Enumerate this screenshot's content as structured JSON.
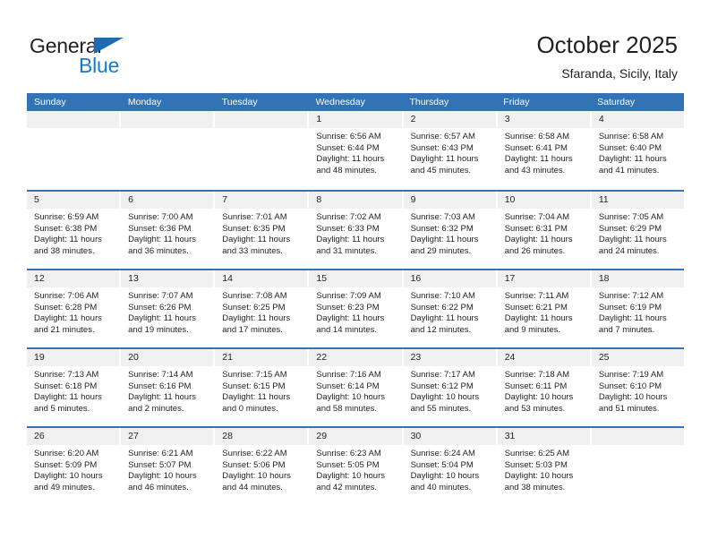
{
  "brand": {
    "name_top": "General",
    "name_bottom": "Blue",
    "triangle_color": "#1c6cb5",
    "text_color": "#231f20",
    "blue_text_color": "#1c79c8"
  },
  "header": {
    "title": "October 2025",
    "subtitle": "Sfaranda, Sicily, Italy"
  },
  "theme": {
    "header_blue": "#3173b5",
    "daynum_band": "#f0f0f0",
    "text": "#231f20",
    "background": "#ffffff"
  },
  "weekday_headers": [
    "Sunday",
    "Monday",
    "Tuesday",
    "Wednesday",
    "Thursday",
    "Friday",
    "Saturday"
  ],
  "weeks": [
    [
      {
        "day": "",
        "empty": true,
        "sunrise": "",
        "sunset": "",
        "daylight_1": "",
        "daylight_2": ""
      },
      {
        "day": "",
        "empty": true,
        "sunrise": "",
        "sunset": "",
        "daylight_1": "",
        "daylight_2": ""
      },
      {
        "day": "",
        "empty": true,
        "sunrise": "",
        "sunset": "",
        "daylight_1": "",
        "daylight_2": ""
      },
      {
        "day": "1",
        "empty": false,
        "sunrise": "Sunrise: 6:56 AM",
        "sunset": "Sunset: 6:44 PM",
        "daylight_1": "Daylight: 11 hours",
        "daylight_2": "and 48 minutes."
      },
      {
        "day": "2",
        "empty": false,
        "sunrise": "Sunrise: 6:57 AM",
        "sunset": "Sunset: 6:43 PM",
        "daylight_1": "Daylight: 11 hours",
        "daylight_2": "and 45 minutes."
      },
      {
        "day": "3",
        "empty": false,
        "sunrise": "Sunrise: 6:58 AM",
        "sunset": "Sunset: 6:41 PM",
        "daylight_1": "Daylight: 11 hours",
        "daylight_2": "and 43 minutes."
      },
      {
        "day": "4",
        "empty": false,
        "sunrise": "Sunrise: 6:58 AM",
        "sunset": "Sunset: 6:40 PM",
        "daylight_1": "Daylight: 11 hours",
        "daylight_2": "and 41 minutes."
      }
    ],
    [
      {
        "day": "5",
        "empty": false,
        "sunrise": "Sunrise: 6:59 AM",
        "sunset": "Sunset: 6:38 PM",
        "daylight_1": "Daylight: 11 hours",
        "daylight_2": "and 38 minutes."
      },
      {
        "day": "6",
        "empty": false,
        "sunrise": "Sunrise: 7:00 AM",
        "sunset": "Sunset: 6:36 PM",
        "daylight_1": "Daylight: 11 hours",
        "daylight_2": "and 36 minutes."
      },
      {
        "day": "7",
        "empty": false,
        "sunrise": "Sunrise: 7:01 AM",
        "sunset": "Sunset: 6:35 PM",
        "daylight_1": "Daylight: 11 hours",
        "daylight_2": "and 33 minutes."
      },
      {
        "day": "8",
        "empty": false,
        "sunrise": "Sunrise: 7:02 AM",
        "sunset": "Sunset: 6:33 PM",
        "daylight_1": "Daylight: 11 hours",
        "daylight_2": "and 31 minutes."
      },
      {
        "day": "9",
        "empty": false,
        "sunrise": "Sunrise: 7:03 AM",
        "sunset": "Sunset: 6:32 PM",
        "daylight_1": "Daylight: 11 hours",
        "daylight_2": "and 29 minutes."
      },
      {
        "day": "10",
        "empty": false,
        "sunrise": "Sunrise: 7:04 AM",
        "sunset": "Sunset: 6:31 PM",
        "daylight_1": "Daylight: 11 hours",
        "daylight_2": "and 26 minutes."
      },
      {
        "day": "11",
        "empty": false,
        "sunrise": "Sunrise: 7:05 AM",
        "sunset": "Sunset: 6:29 PM",
        "daylight_1": "Daylight: 11 hours",
        "daylight_2": "and 24 minutes."
      }
    ],
    [
      {
        "day": "12",
        "empty": false,
        "sunrise": "Sunrise: 7:06 AM",
        "sunset": "Sunset: 6:28 PM",
        "daylight_1": "Daylight: 11 hours",
        "daylight_2": "and 21 minutes."
      },
      {
        "day": "13",
        "empty": false,
        "sunrise": "Sunrise: 7:07 AM",
        "sunset": "Sunset: 6:26 PM",
        "daylight_1": "Daylight: 11 hours",
        "daylight_2": "and 19 minutes."
      },
      {
        "day": "14",
        "empty": false,
        "sunrise": "Sunrise: 7:08 AM",
        "sunset": "Sunset: 6:25 PM",
        "daylight_1": "Daylight: 11 hours",
        "daylight_2": "and 17 minutes."
      },
      {
        "day": "15",
        "empty": false,
        "sunrise": "Sunrise: 7:09 AM",
        "sunset": "Sunset: 6:23 PM",
        "daylight_1": "Daylight: 11 hours",
        "daylight_2": "and 14 minutes."
      },
      {
        "day": "16",
        "empty": false,
        "sunrise": "Sunrise: 7:10 AM",
        "sunset": "Sunset: 6:22 PM",
        "daylight_1": "Daylight: 11 hours",
        "daylight_2": "and 12 minutes."
      },
      {
        "day": "17",
        "empty": false,
        "sunrise": "Sunrise: 7:11 AM",
        "sunset": "Sunset: 6:21 PM",
        "daylight_1": "Daylight: 11 hours",
        "daylight_2": "and 9 minutes."
      },
      {
        "day": "18",
        "empty": false,
        "sunrise": "Sunrise: 7:12 AM",
        "sunset": "Sunset: 6:19 PM",
        "daylight_1": "Daylight: 11 hours",
        "daylight_2": "and 7 minutes."
      }
    ],
    [
      {
        "day": "19",
        "empty": false,
        "sunrise": "Sunrise: 7:13 AM",
        "sunset": "Sunset: 6:18 PM",
        "daylight_1": "Daylight: 11 hours",
        "daylight_2": "and 5 minutes."
      },
      {
        "day": "20",
        "empty": false,
        "sunrise": "Sunrise: 7:14 AM",
        "sunset": "Sunset: 6:16 PM",
        "daylight_1": "Daylight: 11 hours",
        "daylight_2": "and 2 minutes."
      },
      {
        "day": "21",
        "empty": false,
        "sunrise": "Sunrise: 7:15 AM",
        "sunset": "Sunset: 6:15 PM",
        "daylight_1": "Daylight: 11 hours",
        "daylight_2": "and 0 minutes."
      },
      {
        "day": "22",
        "empty": false,
        "sunrise": "Sunrise: 7:16 AM",
        "sunset": "Sunset: 6:14 PM",
        "daylight_1": "Daylight: 10 hours",
        "daylight_2": "and 58 minutes."
      },
      {
        "day": "23",
        "empty": false,
        "sunrise": "Sunrise: 7:17 AM",
        "sunset": "Sunset: 6:12 PM",
        "daylight_1": "Daylight: 10 hours",
        "daylight_2": "and 55 minutes."
      },
      {
        "day": "24",
        "empty": false,
        "sunrise": "Sunrise: 7:18 AM",
        "sunset": "Sunset: 6:11 PM",
        "daylight_1": "Daylight: 10 hours",
        "daylight_2": "and 53 minutes."
      },
      {
        "day": "25",
        "empty": false,
        "sunrise": "Sunrise: 7:19 AM",
        "sunset": "Sunset: 6:10 PM",
        "daylight_1": "Daylight: 10 hours",
        "daylight_2": "and 51 minutes."
      }
    ],
    [
      {
        "day": "26",
        "empty": false,
        "sunrise": "Sunrise: 6:20 AM",
        "sunset": "Sunset: 5:09 PM",
        "daylight_1": "Daylight: 10 hours",
        "daylight_2": "and 49 minutes."
      },
      {
        "day": "27",
        "empty": false,
        "sunrise": "Sunrise: 6:21 AM",
        "sunset": "Sunset: 5:07 PM",
        "daylight_1": "Daylight: 10 hours",
        "daylight_2": "and 46 minutes."
      },
      {
        "day": "28",
        "empty": false,
        "sunrise": "Sunrise: 6:22 AM",
        "sunset": "Sunset: 5:06 PM",
        "daylight_1": "Daylight: 10 hours",
        "daylight_2": "and 44 minutes."
      },
      {
        "day": "29",
        "empty": false,
        "sunrise": "Sunrise: 6:23 AM",
        "sunset": "Sunset: 5:05 PM",
        "daylight_1": "Daylight: 10 hours",
        "daylight_2": "and 42 minutes."
      },
      {
        "day": "30",
        "empty": false,
        "sunrise": "Sunrise: 6:24 AM",
        "sunset": "Sunset: 5:04 PM",
        "daylight_1": "Daylight: 10 hours",
        "daylight_2": "and 40 minutes."
      },
      {
        "day": "31",
        "empty": false,
        "sunrise": "Sunrise: 6:25 AM",
        "sunset": "Sunset: 5:03 PM",
        "daylight_1": "Daylight: 10 hours",
        "daylight_2": "and 38 minutes."
      },
      {
        "day": "",
        "empty": true,
        "sunrise": "",
        "sunset": "",
        "daylight_1": "",
        "daylight_2": ""
      }
    ]
  ]
}
